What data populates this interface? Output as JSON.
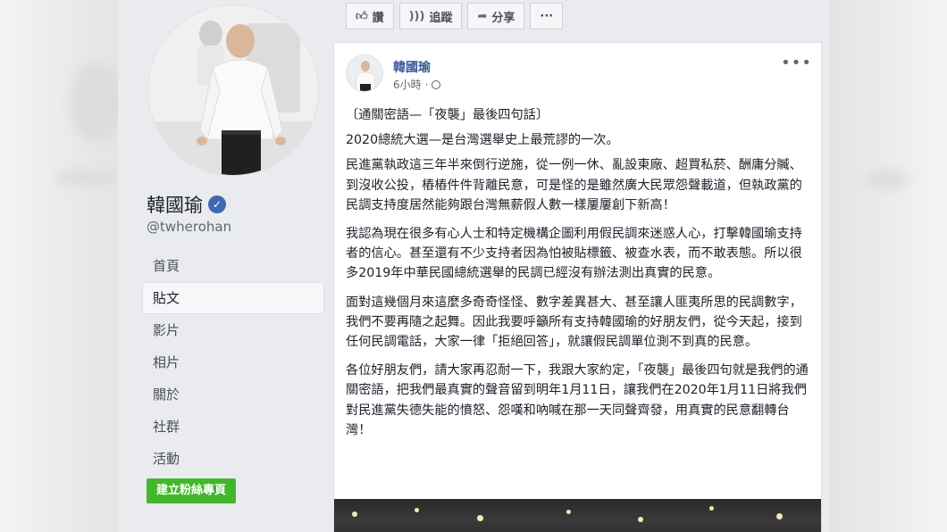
{
  "page": {
    "name": "韓國瑜",
    "username": "@twherohan"
  },
  "nav": {
    "items": [
      {
        "label": "首頁",
        "active": false
      },
      {
        "label": "貼文",
        "active": true
      },
      {
        "label": "影片",
        "active": false
      },
      {
        "label": "相片",
        "active": false
      },
      {
        "label": "關於",
        "active": false
      },
      {
        "label": "社群",
        "active": false
      },
      {
        "label": "活動",
        "active": false
      }
    ],
    "create_page_label": "建立粉絲專頁"
  },
  "actions": {
    "like_label": "讚",
    "follow_label": "追蹤",
    "share_label": "分享",
    "more_label": "···"
  },
  "post": {
    "author": "韓國瑜",
    "time": "6小時",
    "meta_sep": "·",
    "more_label": "•••",
    "paragraphs": [
      "〔通關密語—「夜襲」最後四句話〕",
      "2020總統大選—是台灣選舉史上最荒謬的一次。",
      "民進黨執政這三年半來倒行逆施，從一例一休、亂設東廠、超買私菸、酬庸分贓、到沒收公投，樁樁件件背離民意，可是怪的是雖然廣大民眾怨聲載道，但執政黨的民調支持度居然能夠跟台灣無薪假人數一樣屢屢創下新高！",
      "我認為現在很多有心人士和特定機構企圖利用假民調來迷惑人心，打擊韓國瑜支持者的信心。甚至還有不少支持者因為怕被貼標籤、被查水表，而不敢表態。所以很多2019年中華民國總統選舉的民調已經沒有辦法測出真實的民意。",
      "面對這幾個月來這麼多奇奇怪怪、數字差異甚大、甚至讓人匪夷所思的民調數字，我們不要再隨之起舞。因此我要呼籲所有支持韓國瑜的好朋友們，從今天起，接到任何民調電話，大家一律「拒絕回答」，就讓假民調單位測不到真的民意。",
      "各位好朋友們，請大家再忍耐一下，我跟大家約定，「夜襲」最後四句就是我們的通關密語，把我們最真實的聲音留到明年1月11日，讓我們在2020年1月11日將我們對民進黨失德失能的憤怒、怨嘆和吶喊在那一天同聲齊發，用真實的民意翻轉台灣！"
    ]
  },
  "colors": {
    "link_blue": "#385898",
    "verified_blue": "#4267b2",
    "create_green": "#42b72a",
    "background": "#e9ebee"
  },
  "icons": [
    "verified-badge-icon",
    "thumbs-up-icon",
    "rss-follow-icon",
    "share-arrow-icon",
    "globe-icon",
    "more-horizontal-icon"
  ]
}
